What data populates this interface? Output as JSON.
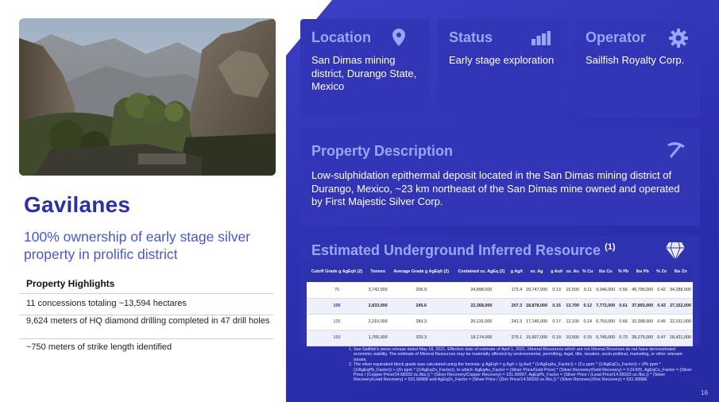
{
  "property": {
    "name": "Gavilanes",
    "tagline": "100% ownership of early stage silver property in prolific district"
  },
  "highlights": {
    "heading": "Property Highlights",
    "items": [
      "11 concessions totaling ~13,594 hectares",
      "9,624 meters of HQ diamond drilling completed in 47 drill holes",
      "~750 meters of strike length identified"
    ]
  },
  "cards": {
    "location": {
      "title": "Location",
      "text": "San Dimas mining district, Durango State, Mexico",
      "icon": "map-pin-icon"
    },
    "status": {
      "title": "Status",
      "text": "Early stage exploration",
      "icon": "bar-chart-icon"
    },
    "operator": {
      "title": "Operator",
      "text": "Sailfish Royalty Corp.",
      "icon": "gear-icon"
    },
    "description": {
      "title": "Property Description",
      "text": "Low-sulphidation epithermal deposit located in the San Dimas mining district of Durango, Mexico, ~23 km northeast of the San Dimas mine owned and operated by First Majestic Silver Corp.",
      "icon": "pickaxe-icon"
    }
  },
  "resource": {
    "title": "Estimated Underground Inferred Resource",
    "title_note": "(1)",
    "icon": "diamond-icon",
    "headers": [
      "Cutoff Grade g AgEq/t (2)",
      "Tonnes",
      "Average Grade g AgEq/t (2)",
      "Contained oz. AgEq (2)",
      "g Ag/t",
      "oz. Ag",
      "g Au/t",
      "oz. Au",
      "% Cu",
      "lbs Cu",
      "% Pb",
      "lbs Pb",
      "% Zn",
      "lbs Zn"
    ],
    "rows": [
      [
        "75",
        "3,742,000",
        "206.9",
        "24,898,000",
        "172.4",
        "20,747,000",
        "0.13",
        "15,500",
        "0.11",
        "9,046,000",
        "0.56",
        "45,795,000",
        "0.42",
        "34,288,000"
      ],
      [
        "100",
        "2,833,000",
        "245.6",
        "22,368,000",
        "207.3",
        "18,878,000",
        "0.15",
        "13,700",
        "0.12",
        "7,772,000",
        "0.61",
        "37,893,000",
        "0.43",
        "27,152,000"
      ],
      [
        "125",
        "2,210,000",
        "283.3",
        "20,131,000",
        "241.3",
        "17,146,000",
        "0.17",
        "12,100",
        "0.14",
        "6,753,000",
        "0.66",
        "32,398,000",
        "0.45",
        "22,011,000"
      ],
      [
        "150",
        "1,765,000",
        "320.3",
        "18,174,000",
        "275.1",
        "15,607,000",
        "0.19",
        "10,500",
        "0.15",
        "5,745,000",
        "0.73",
        "28,275,000",
        "0.47",
        "18,421,000"
      ]
    ],
    "bold_row": 1
  },
  "footnotes": [
    "See Sailfish's press release dated May 18, 2021. Effective date of estimate of April 1, 2021. Mineral Resources which are not Mineral Reserves do not have demonstrated economic viability. The estimate of Mineral Resources may be materially affected by environmental, permitting, legal, title, taxation, socio-political, marketing, or other relevant issues.",
    "The silver equivalent block grade was calculated using the formula: g AgEq/t = g Ag/t + (g Au/t * (1/AgEqAu_Factor)) + (Cu ppm * (1/AgEqCu_Factor)) + (Pb ppm * (1/AgEqPb_Factor)) + (Zn ppm * (1/AgEqZn_Factor)). In which: AgEqAu_Factor = (Silver Price/Gold Price) * (Silver Recovery/Gold Recovery) = 0.01425, AgEqCu_Factor = (Silver Price / (Copper Price/14.58333 oz./lbs.)) * (Silver Recovery/Copper Recovery) = 151.99997, AgEqPb_Factor = (Silver Price / (Lead Price/14.58333 oz./lbs.)) * (Silver Recovery/Lead Recovery) = 531.99988 and AgEqZn_Factor = (Silver Price / (Zinc Price/14.58333 oz./lbs.)) * (Silver Recovery/Zinc Recovery) = 531.99988."
  ],
  "page_number": "16",
  "colors": {
    "panel": "#2d30b0",
    "card": "#3235b6",
    "accent_title": "#9aa6ff",
    "brand_text": "#2b2fa8"
  }
}
